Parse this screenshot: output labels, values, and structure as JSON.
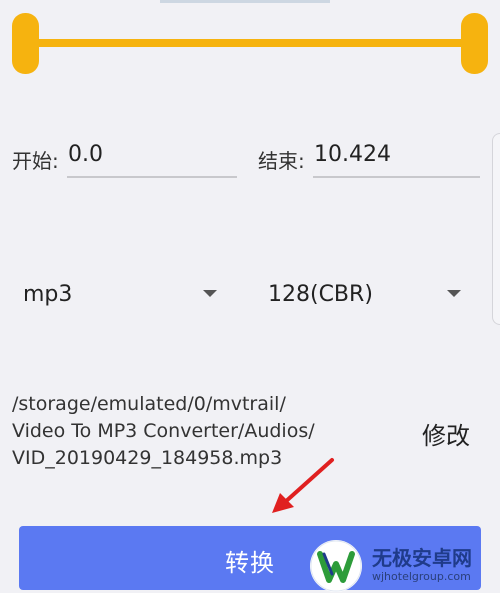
{
  "trim": {
    "start_label": "开始:",
    "start_value": "0.0",
    "end_label": "结束:",
    "end_value": "10.424"
  },
  "format": {
    "selected": "mp3"
  },
  "bitrate": {
    "selected": "128(CBR)"
  },
  "output": {
    "path_lines": [
      "/storage/emulated/0/mvtrail/",
      "Video To MP3 Converter/Audios/",
      "VID_20190429_184958.mp3"
    ],
    "modify_label": "修改"
  },
  "convert_label": "转换",
  "watermark": {
    "title": "无极安卓网",
    "url": "wjhotelgroup.com"
  },
  "colors": {
    "slider": "#f6b30f",
    "button": "#5b79f2",
    "arrow": "#e02020"
  }
}
